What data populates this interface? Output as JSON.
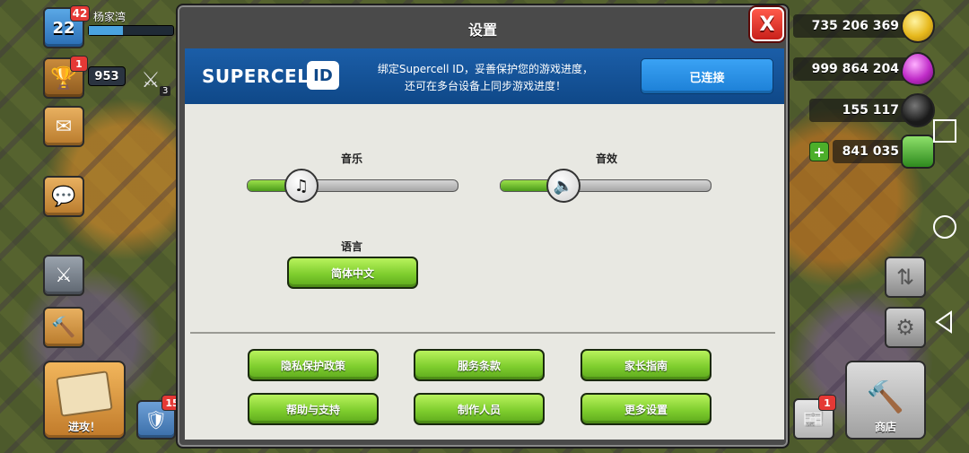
{
  "player": {
    "level": "22",
    "level_badge": "42",
    "name": "杨家湾",
    "trophy_badge": "1",
    "trophies": "953",
    "war_stars": "3"
  },
  "left_buttons": {
    "attack_label": "进攻！",
    "shield_badge": "15"
  },
  "resources": {
    "gold": "735 206 369",
    "elixir": "999 864 204",
    "dark_elixir": "155 117",
    "gems": "841 035"
  },
  "right_buttons": {
    "shop_label": "商店",
    "mail_badge": "1"
  },
  "dialog": {
    "title": "设置",
    "close_label": "X",
    "supercell": {
      "logo_text": "SUPERCELL",
      "logo_id": "ID",
      "desc_line1": "绑定Supercell ID，妥善保护您的游戏进度，",
      "desc_line2": "还可在多台设备上同步游戏进度！",
      "connect_label": "已连接"
    },
    "music": {
      "label": "音乐",
      "level": 0.26
    },
    "sfx": {
      "label": "音效",
      "level": 0.3
    },
    "language": {
      "label": "语言",
      "value": "简体中文"
    },
    "buttons": {
      "privacy": "隐私保护政策",
      "terms": "服务条款",
      "parents": "家长指南",
      "help": "帮助与支持",
      "credits": "制作人员",
      "more": "更多设置"
    }
  },
  "colors": {
    "accent_blue": "#1c7fd6",
    "button_green": "#7fce2e",
    "close_red": "#c8201a"
  }
}
